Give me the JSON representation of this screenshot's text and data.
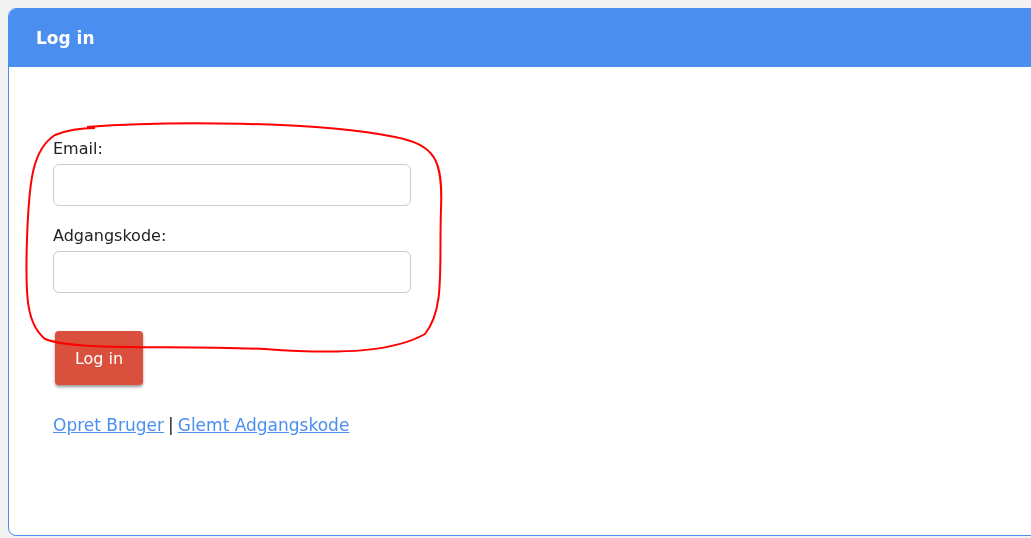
{
  "panel": {
    "title": "Log in"
  },
  "fields": [
    {
      "label": "Email:"
    },
    {
      "label": "Adgangskode:"
    }
  ],
  "annotation": {
    "kind": "loop",
    "color": "#ff0000"
  },
  "button": "Log in",
  "links": [
    {
      "label": "Opret Bruger"
    },
    {
      "label": "Glemt Adgangskode"
    }
  ],
  "separator": "|"
}
